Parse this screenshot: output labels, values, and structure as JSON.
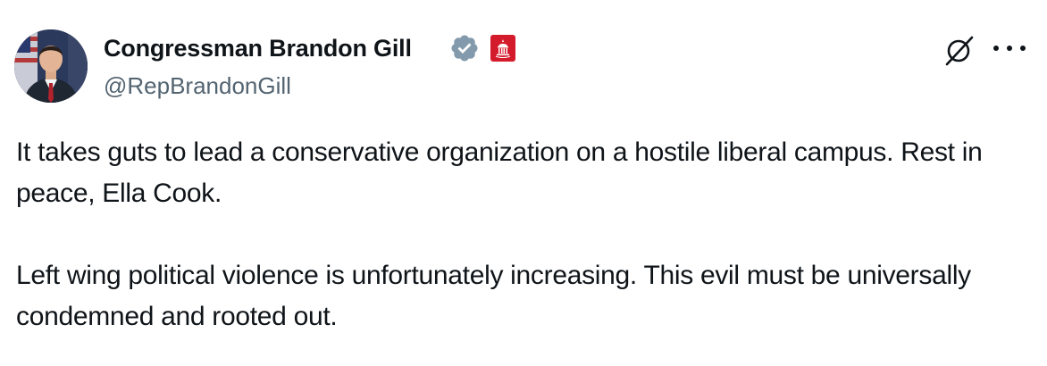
{
  "author": {
    "display_name": "Congressman Brandon Gill",
    "handle": "@RepBrandonGill",
    "verified_icon": "verified-badge-icon",
    "affiliation_icon": "us-house-seal-badge-icon"
  },
  "actions": {
    "grok_icon": "grok-icon",
    "more_icon": "more-options-icon"
  },
  "post": {
    "paragraphs": [
      "It takes guts to lead a conservative organization on a hostile liberal campus. Rest in peace, Ella Cook.",
      "Left wing political violence is unfortunately increasing. This evil must be universally condemned and rooted out."
    ]
  },
  "colors": {
    "text": "#0f1419",
    "secondary_text": "#536471",
    "verified_badge": "#829aab",
    "affiliation_badge": "#d41b2c"
  }
}
